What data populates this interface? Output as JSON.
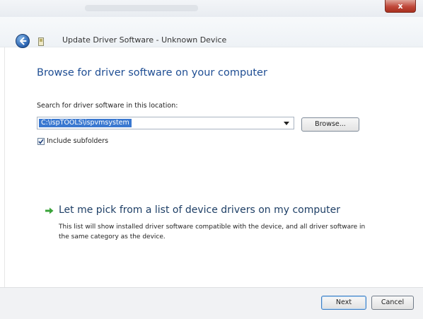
{
  "window": {
    "title": "Update Driver Software - Unknown Device",
    "close_label": "x"
  },
  "main": {
    "heading": "Browse for driver software on your computer",
    "search_label": "Search for driver software in this location:",
    "path_value": "C:\\ispTOOLS\\ispvmsystem",
    "browse_label": "Browse...",
    "include_subfolders": {
      "label": "Include subfolders",
      "checked": true
    }
  },
  "pick": {
    "link_text": "Let me pick from a list of device drivers on my computer",
    "description": "This list will show installed driver software compatible with the device, and all driver software in the same category as the device."
  },
  "footer": {
    "next_label": "Next",
    "cancel_label": "Cancel"
  },
  "colors": {
    "heading": "#1e4d93",
    "selection": "#3a78d0",
    "link": "#1e3f66",
    "arrow": "#3aa33a"
  }
}
